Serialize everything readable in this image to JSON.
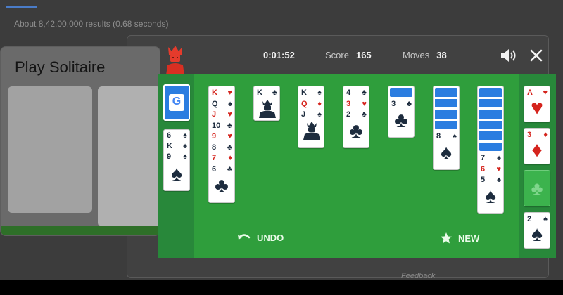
{
  "search": {
    "results_stats": "About 8,42,00,000 results (0.68 seconds)",
    "feedback": "Feedback"
  },
  "background_card": {
    "title": "Play Solitaire"
  },
  "game": {
    "timer": "0:01:52",
    "score_label": "Score",
    "score": "165",
    "moves_label": "Moves",
    "moves": "38",
    "undo_label": "UNDO",
    "new_label": "NEW"
  },
  "stock": {
    "logo": "G"
  },
  "waste": {
    "ranks": [
      "6",
      "K",
      "9"
    ],
    "suit": "spades"
  },
  "tableau": [
    {
      "ranks": [
        "K",
        "Q",
        "J",
        "10",
        "9",
        "8",
        "7",
        "6"
      ],
      "suits": [
        "hearts",
        "spades",
        "hearts",
        "clubs",
        "hearts",
        "clubs",
        "diamonds",
        "clubs"
      ]
    },
    {
      "ranks": [
        "K"
      ],
      "suits": [
        "clubs"
      ]
    },
    {
      "ranks": [
        "K",
        "Q",
        "J"
      ],
      "suits": [
        "spades",
        "diamonds",
        "spades"
      ]
    },
    {
      "ranks": [
        "4",
        "3",
        "2"
      ],
      "suits": [
        "clubs",
        "hearts",
        "clubs"
      ]
    },
    {
      "facedown": 1,
      "ranks": [
        "3"
      ],
      "suits": [
        "clubs"
      ]
    },
    {
      "facedown": 4,
      "ranks": [
        "8"
      ],
      "suits": [
        "spades"
      ]
    },
    {
      "facedown": 6,
      "ranks": [
        "7",
        "6",
        "5"
      ],
      "suits": [
        "spades",
        "hearts",
        "spades"
      ]
    }
  ],
  "foundations": [
    {
      "rank": "A",
      "suit": "hearts"
    },
    {
      "rank": "3",
      "suit": "diamonds"
    },
    {
      "rank": "",
      "suit": "clubs",
      "empty": true
    },
    {
      "rank": "2",
      "suit": "spades"
    }
  ],
  "colors": {
    "felt": "#2f9e3c",
    "side_felt": "#28883a",
    "card_back": "#2b7de0",
    "red_suit": "#d5241d",
    "black_suit": "#1d2c3e"
  }
}
